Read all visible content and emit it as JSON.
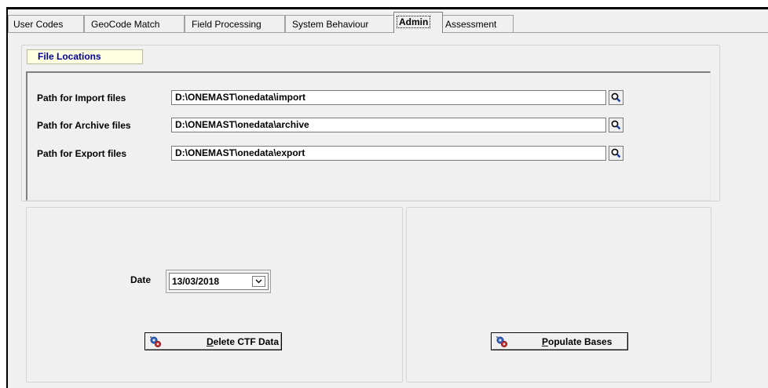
{
  "tabs": [
    {
      "label": "User Codes"
    },
    {
      "label": "GeoCode Match"
    },
    {
      "label": "Field Processing"
    },
    {
      "label": "System Behaviour"
    },
    {
      "label": "Admin"
    },
    {
      "label": "Assessment"
    }
  ],
  "file_locations": {
    "title": "File Locations",
    "rows": [
      {
        "label": "Path for Import files",
        "value": "D:\\ONEMAST\\onedata\\import"
      },
      {
        "label": "Path for Archive files",
        "value": "D:\\ONEMAST\\onedata\\archive"
      },
      {
        "label": "Path for Export files",
        "value": "D:\\ONEMAST\\onedata\\export"
      }
    ]
  },
  "delete_panel": {
    "date_label": "Date",
    "date_value": "13/03/2018",
    "button_mnemonic": "D",
    "button_rest": "elete CTF Data"
  },
  "populate_panel": {
    "button_mnemonic": "P",
    "button_rest": "opulate Bases"
  },
  "icons": {
    "browse": "magnifier-icon",
    "dropdown": "chevron-down-icon",
    "button": "gears-icon"
  }
}
